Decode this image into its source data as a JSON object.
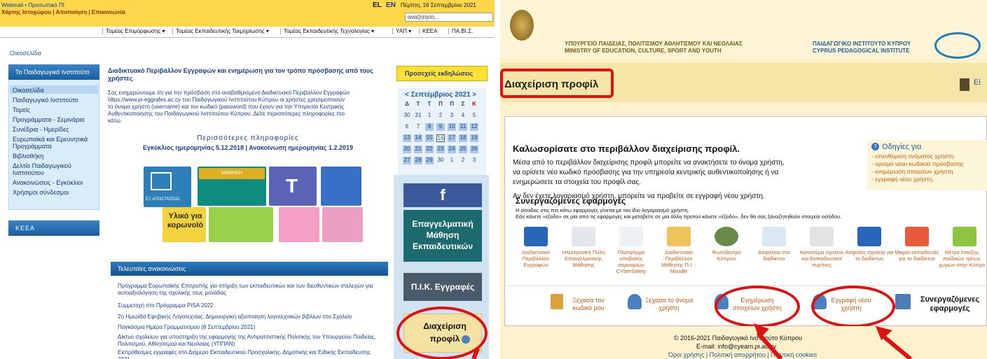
{
  "left": {
    "top_links": "Webmail • Προσωπικό ΠΙ",
    "sitemap_links": "Χάρτης Ιστοχώρου | Αποποίηση | Επικοινωνία",
    "lang_el": "EL",
    "lang_en": "EN",
    "date": "Πέμπτη, 16 Σεπτεμβρίου 2021",
    "search_placeholder": "αναζήτηση...",
    "nav": [
      "Τομέας Επιμόρφωσης ▾",
      "Τομέας Εκπαιδευτικής Τεκμηρίωσης ▾",
      "Τομέας Εκπαιδευτικής Τεχνολογίας ▾",
      "ΥΑΠ ▾",
      "ΚΕΕΑ",
      "ΠΑ.ΒΙ.Σ."
    ],
    "breadcrumb": "Οικοσελίδα",
    "sidebar_title": "Το Παιδαγωγικό Ινστιτούτο",
    "sidebar_items": [
      "Οικοσελίδα",
      "Παιδαγωγικό Ινστιτούτο",
      "Τομείς",
      "Προγράμματα - Σεμινάρια",
      "Συνέδρια - Ημερίδες",
      "Ευρωπαϊκά και Ερευνητικά",
      "Προγράμματα",
      "Βιβλιοθήκη",
      "Δελτίο Παιδαγωγικού",
      "Ινστιτούτου",
      "Ανακοινώσεις - Εγκύκλιοι",
      "Χρήσιμοι σύνδεσμοι"
    ],
    "keea": "ΚΕΕΑ",
    "article_title": "Διαδικτυακό Περιβάλλον Εγγραφών και ενημέρωση για τον τρόπο πρόσβασης από τους χρήστες",
    "article_lines": [
      "Σας ενημερώνουμε ότι για την πρόσβαση στο αναβαθμισμένο Διαδικτυακό Περιβάλλον Εγγραφών",
      "https://www.pi-eggrafes.ac.cy του Παιδαγωγικού Ινστιτούτου Κύπρου οι χρήστες χρησιμοποιούν",
      "το όνομα χρήστη (username) και τον κωδικό (password) που έχουν για την Υπηρεσία Κεντρικής",
      "Αυθεντικοποίησης του Παιδαγωγικού Ινστιτούτου Κύπρου. Δείτε περισσότερες πληροφορίες πιο",
      "κάτω."
    ],
    "more_info": "Περισσότερες πληροφορίες",
    "circular_links": "Εγκύκλιος ημερομηνίας 5.12.2018 | Ανακοίνωση ημερομηνίας 1.2.2019",
    "events_title": "Προσεχείς εκδηλώσεις",
    "calendar_month": "< Σεπτέμβριος 2021 >",
    "calendar_days": [
      "Δ",
      "Τ",
      "Τ",
      "Π",
      "Π",
      "Σ",
      "Κ"
    ],
    "calendar_rows": [
      [
        "30",
        "31",
        "1",
        "2",
        "3",
        "4",
        "5"
      ],
      [
        "6",
        "7",
        "8",
        "9",
        "10",
        "11",
        "12"
      ],
      [
        "13",
        "14",
        "15",
        "16",
        "17",
        "18",
        "19"
      ],
      [
        "20",
        "21",
        "22",
        "23",
        "24",
        "25",
        "26"
      ],
      [
        "27",
        "28",
        "29",
        "30",
        "1",
        "2",
        "3"
      ]
    ],
    "tile_mathisi": "ΜΑΘΗΣΗ",
    "tile_apostaseos": "ΕΞ ΑΠΟΣΤΑΣΕΩΣ",
    "tile_ilikos": "Υλικό για κορωνοϊό",
    "facebook": "f",
    "prof_learning": "Επαγγελματική Μάθηση Εκπαιδευτικών",
    "pik_eggrafes": "Π.Ι.Κ. Εγγραφές",
    "profile_manage": "Διαχείριση προφίλ",
    "news_title": "Τελευταίες ανακοινώσεις",
    "news": [
      "Πρόγραμμα Ευρωπαϊκής Επιτροπής για στήριξη των εκπαιδευτικών και των διευθυντικών στελεχών για αυτοαξιολόγηση της σχολικής τους μονάδας",
      "Συμμετοχή στο Πρόγραμμα PISA 2022",
      "2η Ημερίδα Εφηβικής Λογοτεχνίας: Δημιουργική αξιοποίηση λογοτεχνικών βιβλίων στο Σχολείο",
      "Παγκόσμια Ημέρα Γραμματισμού (8 Σεπτεμβρίου 2021)",
      "Δίκτυο σχολείων για υποστήριξη της εφαρμογής της Αντιρατσιστικής Πολιτικής του Υπουργείου Παιδείας, Πολιτισμού, Αθλητισμού και Νεολαίας (ΥΠΠΑΝ)",
      "Εκπρόθεσμες εγγραφές στο Διήμερο Εκπαιδευτικού Προσχολικής, Δημοτικής και Ειδικής Εκπαίδευσης 2021"
    ]
  },
  "right": {
    "ministry_line1": "ΥΠΟΥΡΓΕΙΟ ΠΑΙΔΕΙΑΣ, ΠΟΛΙΤΙΣΜΟΥ ΑΘΛΗΤΙΣΜΟΥ ΚΑΙ ΝΕΟΛΑΙΑΣ",
    "ministry_line2": "MINISTRY OF EDUCATION, CULTURE, SPORT AND YOUTH",
    "institute_line1": "ΠΑΙΔΑΓΩΓΙΚΟ ΙΝΣΤΙΤΟΥΤΟ ΚΥΠΡΟΥ",
    "institute_line2": "CYPRUS PEDAGOGICAL INSTITUTE",
    "page_title": "Διαχείριση προφίλ",
    "exit_text": "Εί",
    "welcome": "Καλωσορίσατε στο περιβάλλον διαχείρισης προφίλ.",
    "intro1": "Μέσα από το περιβάλλον διαχείρισης προφίλ μπορείτε να ανακτήσετε το όνομα χρήστη,",
    "intro2": "να ορίσετε νέο κωδικό πρόσβασης για την υπηρεσία κεντρικής αυθεντικοποίησης ή να",
    "intro3": "ενημερώσετε τα στοιχεία του προφίλ σας.",
    "intro4": "Αν δεν έχετε λογαριασμό χρήστη, μπορείτε να προβείτε σε εγγραφή νέου χρήστη.",
    "instructions_title": "Οδηγίες για",
    "instructions": [
      "- υπενθύμιση ονόματος χρήστη",
      "- ορισμό νέου κωδικού πρόσβασης",
      "- ενημέρωση στοιχείων χρήστη",
      "- εγγραφή νέου χρήστη."
    ],
    "partner_title": "Συνεργαζόμενες εφαρμογές",
    "partner_note1": "Η είσοδος στις πιο κάτω εφαρμογές γίνεται με τον ίδιο λογαριασμό χρήστη.",
    "partner_note2": "Εάν κάνετε «έξοδο» σε μία από τις εφαρμογές και μεταβείτε σε μία άλλη προτού κάνετε «έξοδο», δεν θα σας ξαναζητηθούν στοιχεία εισόδου.",
    "apps": [
      "Διαδικτυακό Περιβάλλον Εγγραφών",
      "Ηλεκτρονική Πύλη Επαγγελματικής Μάθησης",
      "Πλατφόρμα υποβολής σεμιναρίων CYberSafety",
      "Διαδικτυακό Περιβάλλον Μάθησης Π.Ι. - Moodle",
      "Φωτόδεντρο Κύπρου",
      "Ασφάλεια στο διαδίκτυο",
      "Καινοτόμα σχολεία και Εκπαιδευτικοί πυρήνες",
      "Ασφαλές σχολεία για το διαδίκτυο",
      "Μικροί εκπαιδευτές για το διαδίκτυο",
      "Μέτρα έντοξης παιδικών τρίτων χωρών στην Κύπρο"
    ],
    "action_forgot_password": "Ξέχασα τον κωδικό μου",
    "action_forgot_username": "Ξέχασα το όνομα χρήστη",
    "action_update": "Ενημέρωση στοιχείων χρήστη",
    "action_register": "Εγγραφή νέου χρήστη",
    "partner_button": "Συνεργαζόμενες εφαρμογές",
    "footer_copy": "© 2016-2021 Παιδαγωγικό Ινστιτούτο Κύπρου",
    "footer_email": "E-mail: info@cyearn.pi.ac.cy",
    "footer_links": "Όροι χρήσης | Πολιτική απορρήτου | Πολιτική cookies"
  },
  "colors": {
    "annotation": "#e01010",
    "brand_blue": "#1a5e9f",
    "accent_orange": "#c55a11"
  }
}
